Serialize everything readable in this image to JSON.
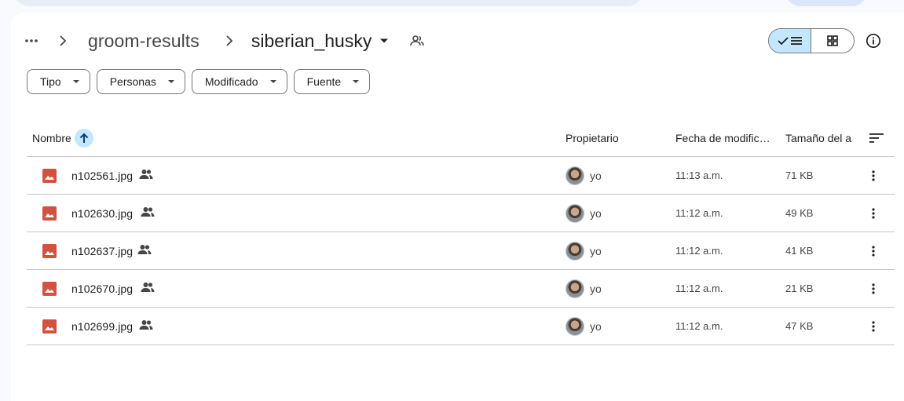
{
  "breadcrumb": {
    "parent": "groom-results",
    "current": "siberian_husky"
  },
  "filters": [
    "Tipo",
    "Personas",
    "Modificado",
    "Fuente"
  ],
  "columns": {
    "name": "Nombre",
    "owner": "Propietario",
    "modified": "Fecha de modific…",
    "size": "Tamaño del a"
  },
  "files": [
    {
      "name": "n102561.jpg",
      "owner": "yo",
      "modified": "11:13 a.m.",
      "size": "71 KB"
    },
    {
      "name": "n102630.jpg",
      "owner": "yo",
      "modified": "11:12 a.m.",
      "size": "49 KB"
    },
    {
      "name": "n102637.jpg",
      "owner": "yo",
      "modified": "11:12 a.m.",
      "size": "41 KB"
    },
    {
      "name": "n102670.jpg",
      "owner": "yo",
      "modified": "11:12 a.m.",
      "size": "21 KB"
    },
    {
      "name": "n102699.jpg",
      "owner": "yo",
      "modified": "11:12 a.m.",
      "size": "47 KB"
    }
  ],
  "colors": {
    "image_icon": "#d1533f",
    "selected": "#c2e7ff",
    "border": "#c4c7c5"
  }
}
